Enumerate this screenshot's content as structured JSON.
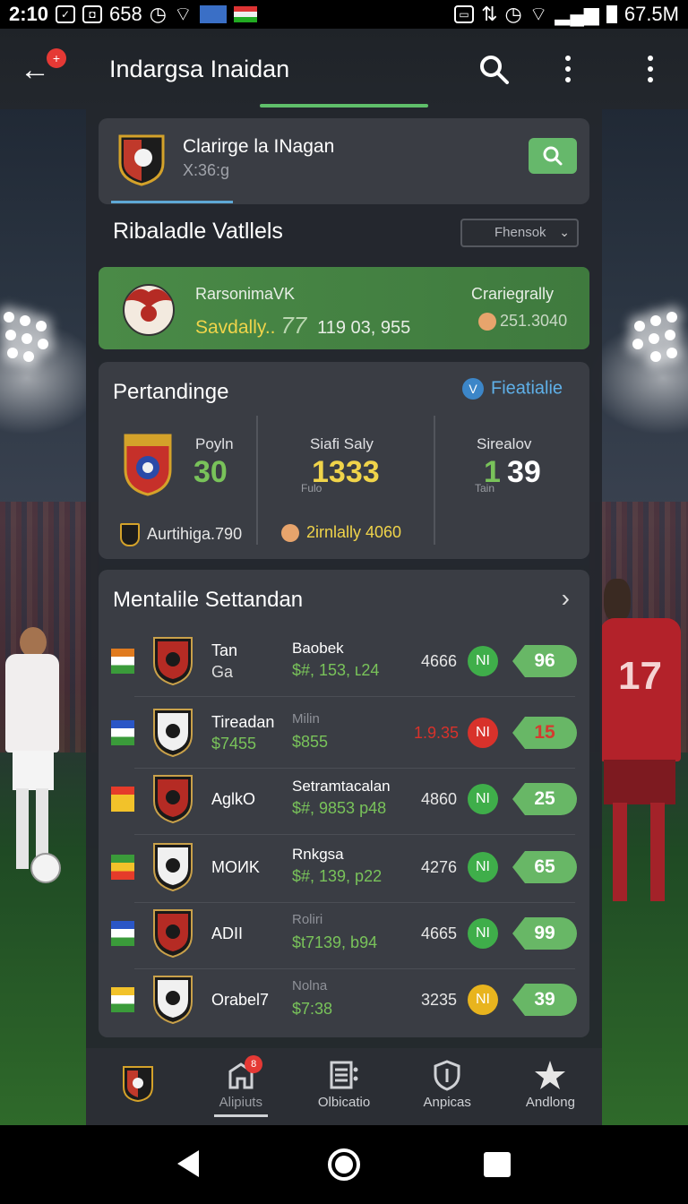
{
  "status_bar": {
    "time": "2:10",
    "notif_count": "658",
    "battery": "67.5M"
  },
  "app_bar": {
    "title": "Indargsa Inaidan",
    "back_badge": "+"
  },
  "search_card": {
    "club_name": "Clarirge la INagan",
    "code": "X:36:g"
  },
  "rivals_section": {
    "title": "Ribaladle Vatllels",
    "dropdown_value": "Fhensok"
  },
  "highlight_card": {
    "label_left": "RarsonimaVK",
    "label_sub": "Savdally..",
    "label_sub_num": "77",
    "value": "119 03, 955",
    "label_right": "Crariegrally",
    "value_right": "251.3040"
  },
  "stats_card": {
    "title": "Pertandinge",
    "feature_label": "Fieatialie",
    "feature_icon_text": "V",
    "col1": {
      "label": "Poyln",
      "value": "30",
      "footer": "Aurtihiga.790"
    },
    "col2": {
      "label": "Siafi Saly",
      "small": "Fulo",
      "value": "1333",
      "footer": "2irnlally 4060"
    },
    "col3": {
      "label": "Sirealov",
      "small": "Tain",
      "value_green": "1",
      "value": "39"
    }
  },
  "table": {
    "title": "Mentalile Settandan",
    "rows": [
      {
        "team": "Tan",
        "team2": "Ga",
        "sub1": "Baobek",
        "sub2": "$#, 153, ʟ24",
        "num": "4666",
        "dot": "NI",
        "dot_color": "#3fae4a",
        "score": "96",
        "score_red": false,
        "flag": [
          "#e07b1f",
          "#ffffff",
          "#3a9b3a"
        ]
      },
      {
        "team": "Tireadan",
        "team2": "$7455",
        "sub1": "Milin",
        "sub2": "$855",
        "num": "1.9.35",
        "dot": "NI",
        "dot_color": "#d8322b",
        "score": "15",
        "score_red": true,
        "flag": [
          "#2a56c6",
          "#ffffff",
          "#3a9b3a"
        ]
      },
      {
        "team": "AglkO",
        "team2": "",
        "sub1": "Setramtacalan",
        "sub2": "$#, 9853 p48",
        "num": "4860",
        "dot": "NI",
        "dot_color": "#3fae4a",
        "score": "25",
        "score_red": false,
        "flag": [
          "#e53b2a",
          "#f2c22a",
          "#f2c22a"
        ]
      },
      {
        "team": "MOИK",
        "team2": "",
        "sub1": "Rnkgsa",
        "sub2": "$#, 139,  p22",
        "num": "4276",
        "dot": "NI",
        "dot_color": "#3fae4a",
        "score": "65",
        "score_red": false,
        "flag": [
          "#3a9b3a",
          "#f2c22a",
          "#e53b2a"
        ]
      },
      {
        "team": "ADII",
        "team2": "",
        "sub1": "Roliri",
        "sub2": "$t7139,  b94",
        "num": "4665",
        "dot": "NI",
        "dot_color": "#3fae4a",
        "score": "99",
        "score_red": false,
        "flag": [
          "#2a56c6",
          "#ffffff",
          "#3a9b3a"
        ]
      },
      {
        "team": "Orabel7",
        "team2": "",
        "sub1": "Nolna",
        "sub2": "$7:38",
        "num": "3235",
        "dot": "NI",
        "dot_color": "#e8b41e",
        "score": "39",
        "score_red": false,
        "flag": [
          "#f2c22a",
          "#ffffff",
          "#3a9b3a"
        ]
      }
    ]
  },
  "bottom_nav": {
    "items": [
      {
        "label": "",
        "icon": "club-crest-icon"
      },
      {
        "label": "Alipiuts",
        "icon": "home-icon",
        "badge": "8"
      },
      {
        "label": "Olbicatio",
        "icon": "list-icon"
      },
      {
        "label": "Anpicas",
        "icon": "shield-icon"
      },
      {
        "label": "Andlong",
        "icon": "star-icon"
      }
    ]
  },
  "colors": {
    "accent_green": "#68b766",
    "accent_blue": "#5fb0e8",
    "value_yellow": "#f0d44a",
    "panel_bg": "#24272d",
    "card_bg": "#3a3d44"
  }
}
